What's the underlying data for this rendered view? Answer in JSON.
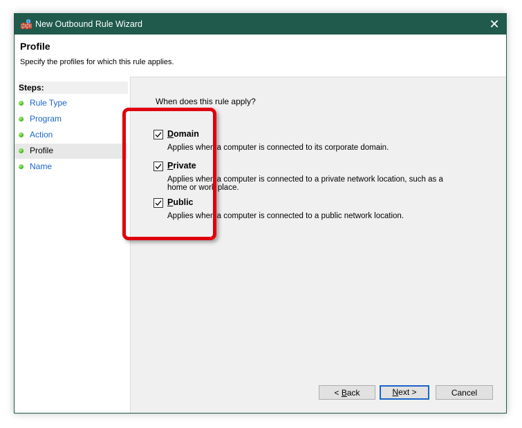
{
  "window": {
    "title": "New Outbound Rule Wizard"
  },
  "header": {
    "title": "Profile",
    "subtitle": "Specify the profiles for which this rule applies."
  },
  "steps": {
    "title": "Steps:",
    "items": [
      {
        "label": "Rule Type"
      },
      {
        "label": "Program"
      },
      {
        "label": "Action"
      },
      {
        "label": "Profile",
        "active": true
      },
      {
        "label": "Name"
      }
    ]
  },
  "content": {
    "question": "When does this rule apply?",
    "options": [
      {
        "accel": "D",
        "rest": "omain",
        "checked": true,
        "desc": "Applies when a computer is connected to its corporate domain."
      },
      {
        "accel": "P",
        "rest": "rivate",
        "checked": true,
        "desc": "Applies when a computer is connected to a private network location, such as a home or work place."
      },
      {
        "accel": "P",
        "rest": "ublic",
        "checked": true,
        "desc": "Applies when a computer is connected to a public network location."
      }
    ]
  },
  "buttons": {
    "back": {
      "prefix": "< ",
      "accel": "B",
      "rest": "ack"
    },
    "next": {
      "accel": "N",
      "rest": "ext >"
    },
    "cancel": "Cancel"
  },
  "colors": {
    "titlebar": "#1f5a4c",
    "highlight": "#e0000d",
    "link": "#1a64c8"
  }
}
